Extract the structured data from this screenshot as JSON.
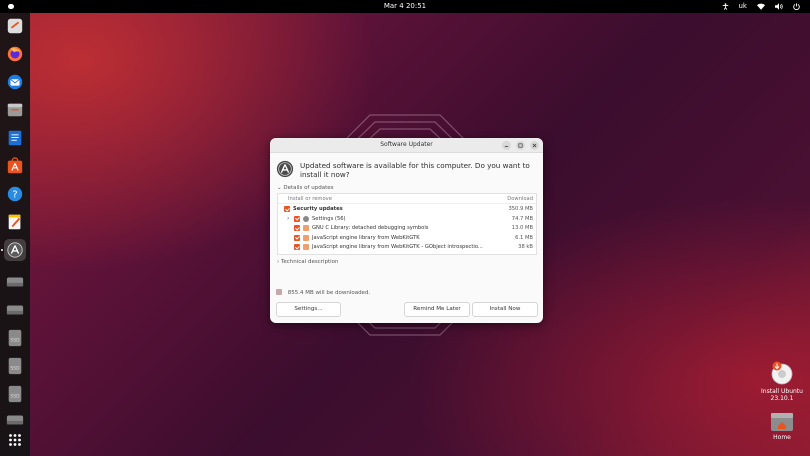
{
  "topbar": {
    "clock": "Mar 4  20:51",
    "keyboard_layout": "uk"
  },
  "dock": {
    "items": [
      {
        "icon": "chat-app-icon"
      },
      {
        "icon": "firefox-icon"
      },
      {
        "icon": "thunderbird-icon"
      },
      {
        "icon": "files-icon"
      },
      {
        "icon": "writer-icon"
      },
      {
        "icon": "app-center-icon"
      },
      {
        "icon": "help-icon"
      },
      {
        "icon": "text-editor-icon"
      },
      {
        "icon": "software-updater-icon"
      },
      {
        "icon": "drive-icon"
      },
      {
        "icon": "drive-icon"
      },
      {
        "icon": "ssd-icon"
      },
      {
        "icon": "ssd-icon"
      },
      {
        "icon": "ssd-icon"
      },
      {
        "icon": "drive-icon"
      },
      {
        "icon": "show-apps-icon"
      }
    ]
  },
  "dialog": {
    "title": "Software Updater",
    "message": "Updated software is available for this computer. Do you want to install it now?",
    "details_label": "Details of updates",
    "columns": {
      "name": "Install or remove",
      "size": "Download"
    },
    "rows": [
      {
        "label": "Security updates",
        "size": "350.9 MB"
      },
      {
        "label": "Settings (56)",
        "size": "74.7 MB"
      },
      {
        "label": "GNU C Library: detached debugging symbols",
        "size": "13.0 MB"
      },
      {
        "label": "JavaScript engine library from WebKitGTK",
        "size": "6.1 MB"
      },
      {
        "label": "JavaScript engine library from WebKitGTK - GObject introspectio...",
        "size": "38 kB"
      }
    ],
    "technical_label": "Technical description",
    "download_total": "855.4 MB will be downloaded.",
    "buttons": {
      "settings": "Settings...",
      "remind": "Remind Me Later",
      "install": "Install Now"
    }
  },
  "desktop_icons": {
    "installer": "Install Ubuntu 23.10.1",
    "home": "Home"
  },
  "colors": {
    "accent": "#e95420",
    "topbar": "#000000",
    "dock": "#141414"
  }
}
